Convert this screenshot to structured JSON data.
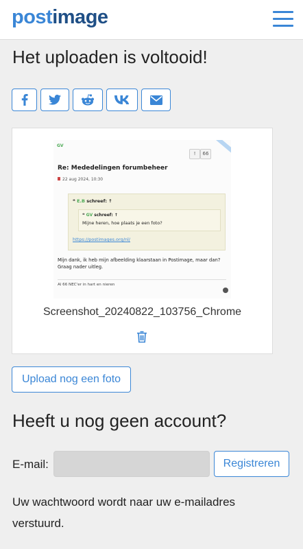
{
  "header": {
    "logo_part1": "post",
    "logo_part2": "image",
    "menu_icon": "hamburger-menu-icon",
    "accent": "#3a86d6"
  },
  "main": {
    "title": "Het uploaden is voltooid!",
    "share_buttons": [
      {
        "icon": "facebook-icon"
      },
      {
        "icon": "twitter-icon"
      },
      {
        "icon": "reddit-icon"
      },
      {
        "icon": "vk-icon"
      },
      {
        "icon": "email-icon"
      }
    ]
  },
  "upload": {
    "preview": {
      "tag": "GV",
      "btn1": "!",
      "btn2": "66",
      "title": "Re: Mededelingen forumbeheer",
      "date": "22 aug 2024, 10:30",
      "outer_author": "E.B",
      "outer_suffix": "schreef: ↑",
      "inner_author": "GV",
      "inner_suffix": "schreef: ↑",
      "inner_text": "Mijne heren, hoe plaats je een foto?",
      "link": "https://postimages.org/nl/",
      "body": "Mijn dank, ik heb mijn afbeelding klaarstaan in Postimage, maar dan? Graag nader uitleg.",
      "signature": "Al 66 NEC'er in hart en nieren"
    },
    "filename": "Screenshot_20240822_103756_Chrome",
    "delete_icon": "trash-icon",
    "upload_more_label": "Upload nog een foto"
  },
  "account": {
    "title": "Heeft u nog geen account?",
    "email_label": "E-mail:",
    "email_value": "",
    "register_label": "Registreren",
    "note": "Uw wachtwoord wordt naar uw e-mailadres verstuurd."
  }
}
